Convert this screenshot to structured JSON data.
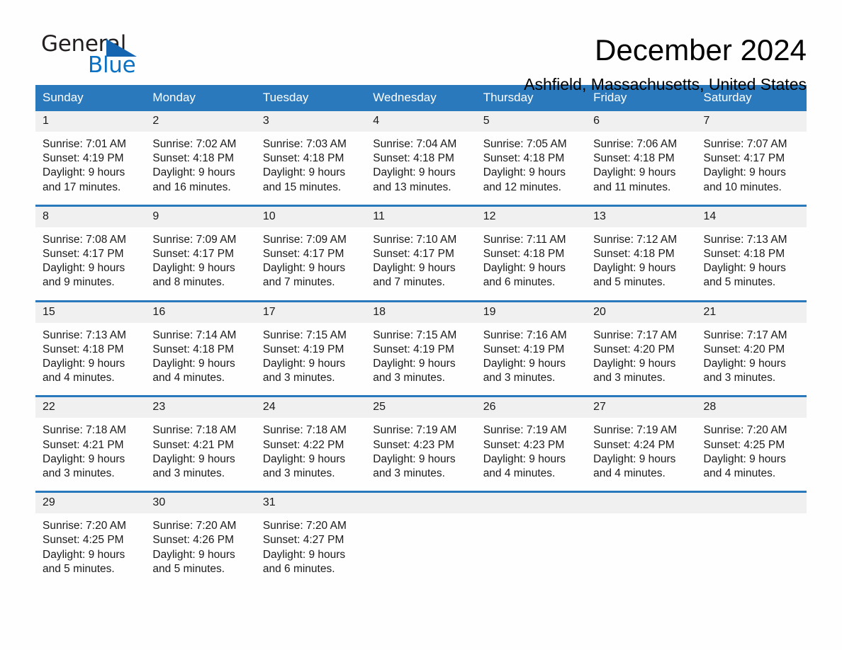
{
  "brand": {
    "name_part1": "General",
    "name_part2": "Blue",
    "accent_color": "#0a72c4",
    "triangle_color": "#1565b0"
  },
  "header": {
    "title": "December 2024",
    "location": "Ashfield, Massachusetts, United States"
  },
  "calendar": {
    "header_bg": "#2b79bd",
    "daynum_bg": "#f0f0f0",
    "weekdays": [
      "Sunday",
      "Monday",
      "Tuesday",
      "Wednesday",
      "Thursday",
      "Friday",
      "Saturday"
    ],
    "weeks": [
      [
        {
          "day": "1",
          "sunrise": "Sunrise: 7:01 AM",
          "sunset": "Sunset: 4:19 PM",
          "daylight_line1": "Daylight: 9 hours",
          "daylight_line2": "and 17 minutes."
        },
        {
          "day": "2",
          "sunrise": "Sunrise: 7:02 AM",
          "sunset": "Sunset: 4:18 PM",
          "daylight_line1": "Daylight: 9 hours",
          "daylight_line2": "and 16 minutes."
        },
        {
          "day": "3",
          "sunrise": "Sunrise: 7:03 AM",
          "sunset": "Sunset: 4:18 PM",
          "daylight_line1": "Daylight: 9 hours",
          "daylight_line2": "and 15 minutes."
        },
        {
          "day": "4",
          "sunrise": "Sunrise: 7:04 AM",
          "sunset": "Sunset: 4:18 PM",
          "daylight_line1": "Daylight: 9 hours",
          "daylight_line2": "and 13 minutes."
        },
        {
          "day": "5",
          "sunrise": "Sunrise: 7:05 AM",
          "sunset": "Sunset: 4:18 PM",
          "daylight_line1": "Daylight: 9 hours",
          "daylight_line2": "and 12 minutes."
        },
        {
          "day": "6",
          "sunrise": "Sunrise: 7:06 AM",
          "sunset": "Sunset: 4:18 PM",
          "daylight_line1": "Daylight: 9 hours",
          "daylight_line2": "and 11 minutes."
        },
        {
          "day": "7",
          "sunrise": "Sunrise: 7:07 AM",
          "sunset": "Sunset: 4:17 PM",
          "daylight_line1": "Daylight: 9 hours",
          "daylight_line2": "and 10 minutes."
        }
      ],
      [
        {
          "day": "8",
          "sunrise": "Sunrise: 7:08 AM",
          "sunset": "Sunset: 4:17 PM",
          "daylight_line1": "Daylight: 9 hours",
          "daylight_line2": "and 9 minutes."
        },
        {
          "day": "9",
          "sunrise": "Sunrise: 7:09 AM",
          "sunset": "Sunset: 4:17 PM",
          "daylight_line1": "Daylight: 9 hours",
          "daylight_line2": "and 8 minutes."
        },
        {
          "day": "10",
          "sunrise": "Sunrise: 7:09 AM",
          "sunset": "Sunset: 4:17 PM",
          "daylight_line1": "Daylight: 9 hours",
          "daylight_line2": "and 7 minutes."
        },
        {
          "day": "11",
          "sunrise": "Sunrise: 7:10 AM",
          "sunset": "Sunset: 4:17 PM",
          "daylight_line1": "Daylight: 9 hours",
          "daylight_line2": "and 7 minutes."
        },
        {
          "day": "12",
          "sunrise": "Sunrise: 7:11 AM",
          "sunset": "Sunset: 4:18 PM",
          "daylight_line1": "Daylight: 9 hours",
          "daylight_line2": "and 6 minutes."
        },
        {
          "day": "13",
          "sunrise": "Sunrise: 7:12 AM",
          "sunset": "Sunset: 4:18 PM",
          "daylight_line1": "Daylight: 9 hours",
          "daylight_line2": "and 5 minutes."
        },
        {
          "day": "14",
          "sunrise": "Sunrise: 7:13 AM",
          "sunset": "Sunset: 4:18 PM",
          "daylight_line1": "Daylight: 9 hours",
          "daylight_line2": "and 5 minutes."
        }
      ],
      [
        {
          "day": "15",
          "sunrise": "Sunrise: 7:13 AM",
          "sunset": "Sunset: 4:18 PM",
          "daylight_line1": "Daylight: 9 hours",
          "daylight_line2": "and 4 minutes."
        },
        {
          "day": "16",
          "sunrise": "Sunrise: 7:14 AM",
          "sunset": "Sunset: 4:18 PM",
          "daylight_line1": "Daylight: 9 hours",
          "daylight_line2": "and 4 minutes."
        },
        {
          "day": "17",
          "sunrise": "Sunrise: 7:15 AM",
          "sunset": "Sunset: 4:19 PM",
          "daylight_line1": "Daylight: 9 hours",
          "daylight_line2": "and 3 minutes."
        },
        {
          "day": "18",
          "sunrise": "Sunrise: 7:15 AM",
          "sunset": "Sunset: 4:19 PM",
          "daylight_line1": "Daylight: 9 hours",
          "daylight_line2": "and 3 minutes."
        },
        {
          "day": "19",
          "sunrise": "Sunrise: 7:16 AM",
          "sunset": "Sunset: 4:19 PM",
          "daylight_line1": "Daylight: 9 hours",
          "daylight_line2": "and 3 minutes."
        },
        {
          "day": "20",
          "sunrise": "Sunrise: 7:17 AM",
          "sunset": "Sunset: 4:20 PM",
          "daylight_line1": "Daylight: 9 hours",
          "daylight_line2": "and 3 minutes."
        },
        {
          "day": "21",
          "sunrise": "Sunrise: 7:17 AM",
          "sunset": "Sunset: 4:20 PM",
          "daylight_line1": "Daylight: 9 hours",
          "daylight_line2": "and 3 minutes."
        }
      ],
      [
        {
          "day": "22",
          "sunrise": "Sunrise: 7:18 AM",
          "sunset": "Sunset: 4:21 PM",
          "daylight_line1": "Daylight: 9 hours",
          "daylight_line2": "and 3 minutes."
        },
        {
          "day": "23",
          "sunrise": "Sunrise: 7:18 AM",
          "sunset": "Sunset: 4:21 PM",
          "daylight_line1": "Daylight: 9 hours",
          "daylight_line2": "and 3 minutes."
        },
        {
          "day": "24",
          "sunrise": "Sunrise: 7:18 AM",
          "sunset": "Sunset: 4:22 PM",
          "daylight_line1": "Daylight: 9 hours",
          "daylight_line2": "and 3 minutes."
        },
        {
          "day": "25",
          "sunrise": "Sunrise: 7:19 AM",
          "sunset": "Sunset: 4:23 PM",
          "daylight_line1": "Daylight: 9 hours",
          "daylight_line2": "and 3 minutes."
        },
        {
          "day": "26",
          "sunrise": "Sunrise: 7:19 AM",
          "sunset": "Sunset: 4:23 PM",
          "daylight_line1": "Daylight: 9 hours",
          "daylight_line2": "and 4 minutes."
        },
        {
          "day": "27",
          "sunrise": "Sunrise: 7:19 AM",
          "sunset": "Sunset: 4:24 PM",
          "daylight_line1": "Daylight: 9 hours",
          "daylight_line2": "and 4 minutes."
        },
        {
          "day": "28",
          "sunrise": "Sunrise: 7:20 AM",
          "sunset": "Sunset: 4:25 PM",
          "daylight_line1": "Daylight: 9 hours",
          "daylight_line2": "and 4 minutes."
        }
      ],
      [
        {
          "day": "29",
          "sunrise": "Sunrise: 7:20 AM",
          "sunset": "Sunset: 4:25 PM",
          "daylight_line1": "Daylight: 9 hours",
          "daylight_line2": "and 5 minutes."
        },
        {
          "day": "30",
          "sunrise": "Sunrise: 7:20 AM",
          "sunset": "Sunset: 4:26 PM",
          "daylight_line1": "Daylight: 9 hours",
          "daylight_line2": "and 5 minutes."
        },
        {
          "day": "31",
          "sunrise": "Sunrise: 7:20 AM",
          "sunset": "Sunset: 4:27 PM",
          "daylight_line1": "Daylight: 9 hours",
          "daylight_line2": "and 6 minutes."
        },
        {
          "day": "",
          "sunrise": "",
          "sunset": "",
          "daylight_line1": "",
          "daylight_line2": ""
        },
        {
          "day": "",
          "sunrise": "",
          "sunset": "",
          "daylight_line1": "",
          "daylight_line2": ""
        },
        {
          "day": "",
          "sunrise": "",
          "sunset": "",
          "daylight_line1": "",
          "daylight_line2": ""
        },
        {
          "day": "",
          "sunrise": "",
          "sunset": "",
          "daylight_line1": "",
          "daylight_line2": ""
        }
      ]
    ]
  }
}
